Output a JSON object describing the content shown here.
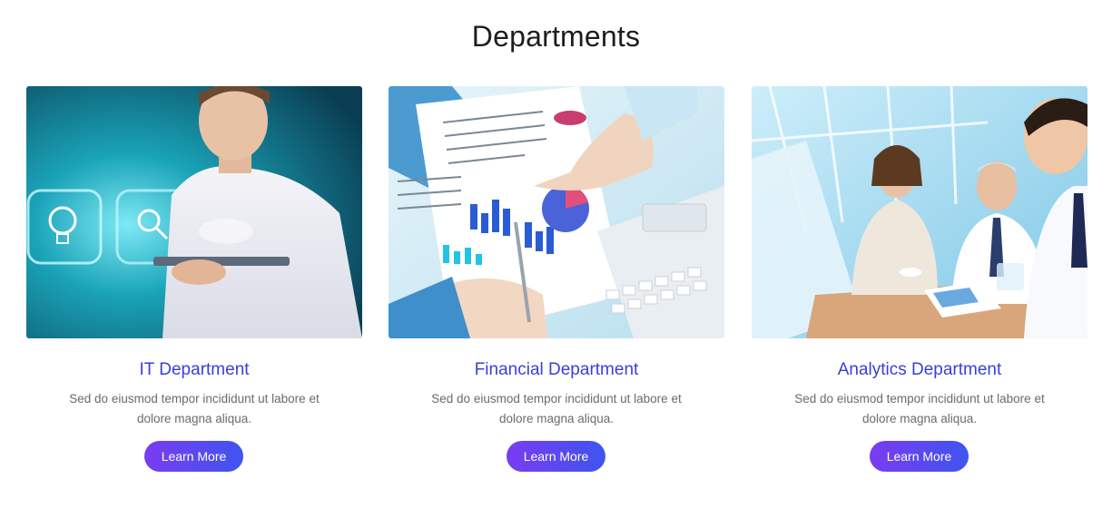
{
  "section": {
    "title": "Departments"
  },
  "departments": [
    {
      "title": "IT Department",
      "description": "Sed do eiusmod tempor incididunt ut labore et dolore magna aliqua.",
      "button_label": "Learn More",
      "image_icon": "it-photo"
    },
    {
      "title": "Financial Department",
      "description": "Sed do eiusmod tempor incididunt ut labore et dolore magna aliqua.",
      "button_label": "Learn More",
      "image_icon": "finance-photo"
    },
    {
      "title": "Analytics Department",
      "description": "Sed do eiusmod tempor incididunt ut labore et dolore magna aliqua.",
      "button_label": "Learn More",
      "image_icon": "analytics-photo"
    }
  ],
  "colors": {
    "title": "#1d1d1f",
    "card_title": "#3a3fd8",
    "body_text": "#6b6b6b",
    "button_gradient_start": "#7a3cf0",
    "button_gradient_end": "#3f54f0"
  }
}
